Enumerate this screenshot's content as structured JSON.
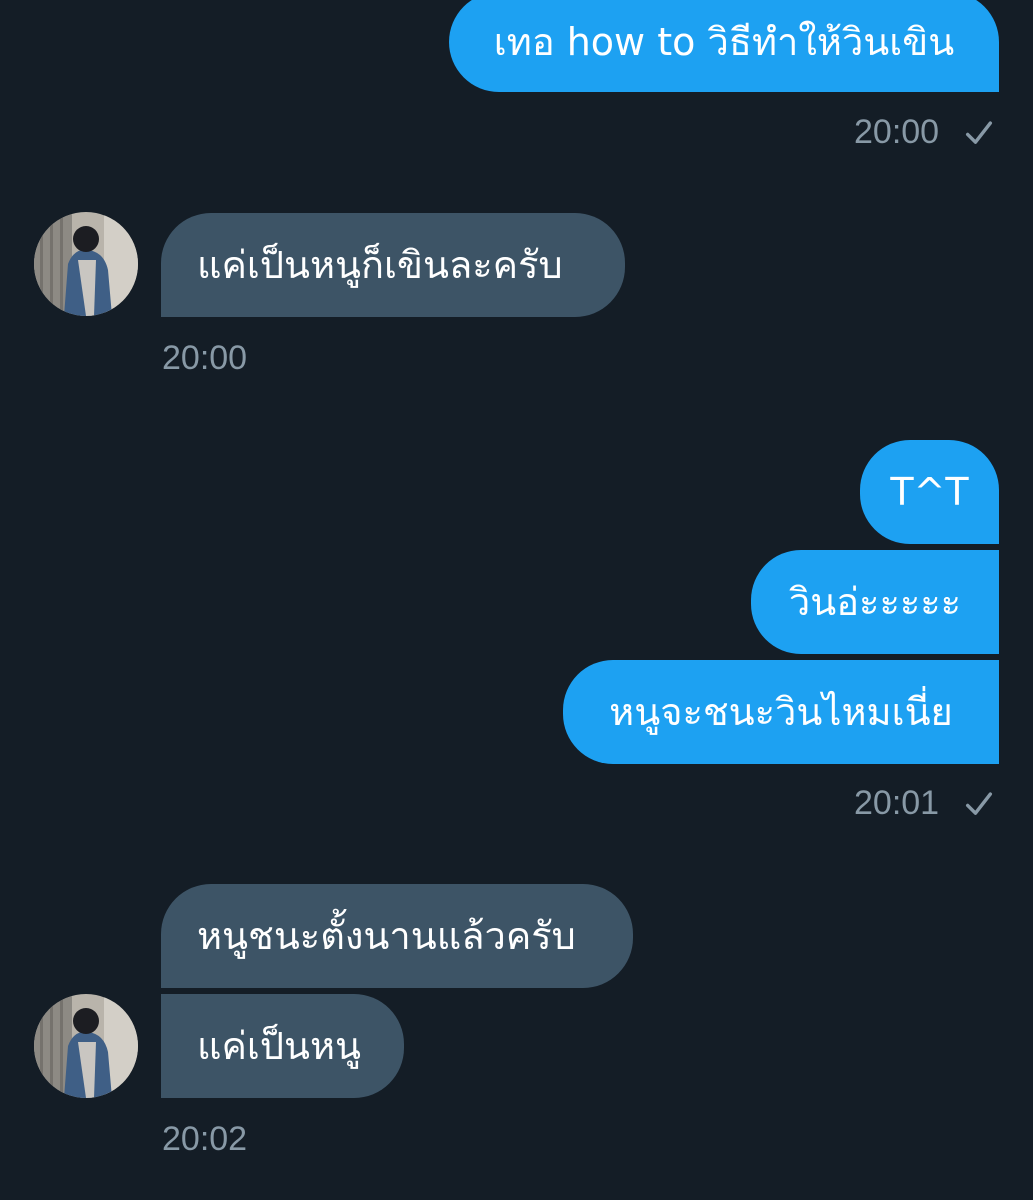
{
  "messages": {
    "m1": {
      "text": "เทอ how to วิธีทำให้วินเขิน",
      "side": "sent"
    },
    "t1": {
      "time": "20:00",
      "status": "read-check-icon"
    },
    "m2": {
      "text": "แค่เป็นหนูก็เขินละครับ",
      "side": "received"
    },
    "t2": {
      "time": "20:00"
    },
    "m3": {
      "text": "T^T",
      "side": "sent"
    },
    "m4": {
      "text": "วินอ่ะะะะะ",
      "side": "sent"
    },
    "m5": {
      "text": "หนูจะชนะวินไหมเนี่ย",
      "side": "sent"
    },
    "t3": {
      "time": "20:01",
      "status": "read-check-icon"
    },
    "m6": {
      "text": "หนูชนะตั้งนานแล้วครับ",
      "side": "received"
    },
    "m7": {
      "text": "แค่เป็นหนู",
      "side": "received"
    },
    "t4": {
      "time": "20:02"
    }
  },
  "colors": {
    "background": "#141d26",
    "sent_bubble": "#1da1f2",
    "received_bubble": "#3d5466",
    "timestamp": "#8899a6",
    "text": "#ffffff"
  }
}
